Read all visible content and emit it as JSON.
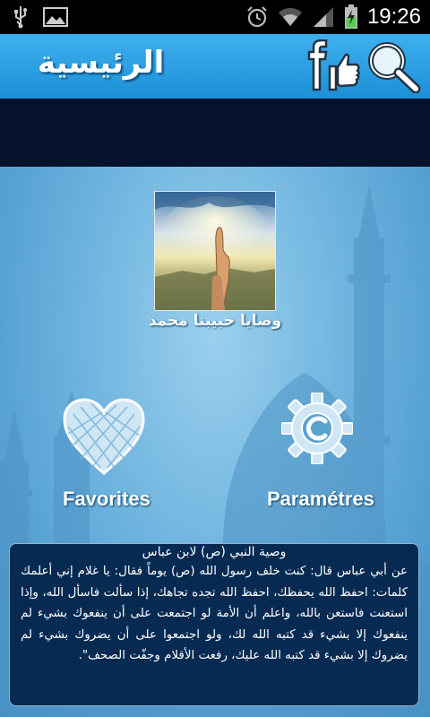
{
  "status_bar": {
    "time": "19:26",
    "left_icons": [
      "usb-icon",
      "image-icon"
    ],
    "right_icons": [
      "alarm-icon",
      "wifi-icon",
      "signal-icon",
      "battery-charging-icon"
    ]
  },
  "action_bar": {
    "title": "الرئيسية",
    "buttons": [
      "facebook-like-icon",
      "search-icon"
    ]
  },
  "main": {
    "tile_label": "وصايا حبيبنا محمد",
    "favorites_label": "Favorites",
    "parameters_label": "Paramétres"
  },
  "hadith": {
    "title": "وصية النبي (ص) لابن عباس",
    "body": "عن أبي عباس قال: كنت خلف رسول الله (ص) يوماً فقال: يا غلام إني أعلمك كلمات: احفظ الله يحفظك، احفظ الله تجده تجاهك، إذا سألت فاسأل الله، وإذا استعنت فاستعن بالله، واعلم أن الأمة لو اجتمعت على أن ينفعوك بشيء لم ينفعوك إلا بشيء قد كتبه الله لك، ولو اجتمعوا على أن يضروك بشيء لم يضروك إلا بشيء قد كتبه الله عليك، رفعت الأقلام وجفّت الصحف\"."
  },
  "colors": {
    "action_bar": "#1c8fd6",
    "band": "#04122b",
    "card": "#062a52",
    "background": "#5aa3cf"
  }
}
